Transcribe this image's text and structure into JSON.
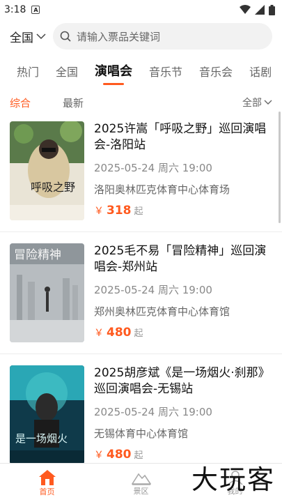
{
  "status": {
    "time": "3:18",
    "a_icon": "A"
  },
  "header": {
    "region": "全国",
    "search_placeholder": "请输入票品关键词"
  },
  "categories": [
    "热门",
    "全国",
    "演唱会",
    "音乐节",
    "音乐会",
    "话剧"
  ],
  "filters": {
    "items": [
      "综合",
      "最新"
    ],
    "right": "全部"
  },
  "events": [
    {
      "title": "2025许嵩「呼吸之野」巡回演唱会-洛阳站",
      "date": "2025-05-24 周六 19:00",
      "venue": "洛阳奥林匹克体育中心体育场",
      "currency": "￥",
      "price": "318",
      "suffix": "起"
    },
    {
      "title": "2025毛不易「冒险精神」巡回演唱会-郑州站",
      "date": "2025-05-24 周六 19:00",
      "venue": "郑州奥林匹克体育中心体育馆",
      "currency": "￥",
      "price": "480",
      "suffix": "起"
    },
    {
      "title": "2025胡彦斌《是一场烟火·刹那》巡回演唱会-无锡站",
      "date": "2025-05-24 周六 19:00",
      "venue": "无锡体育中心体育馆",
      "currency": "￥",
      "price": "480",
      "suffix": "起"
    }
  ],
  "nav": {
    "home": "首页",
    "scenic": "景区",
    "mine": "我的"
  },
  "watermark": "大玩客",
  "colors": {
    "accent": "#ff5a1f"
  }
}
